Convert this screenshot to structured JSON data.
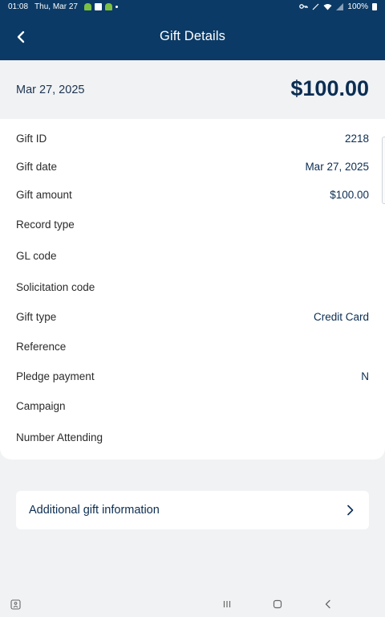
{
  "status_bar": {
    "time": "01:08",
    "date": "Thu, Mar 27",
    "battery": "100%"
  },
  "app_bar": {
    "title": "Gift Details"
  },
  "summary": {
    "date": "Mar 27, 2025",
    "amount": "$100.00"
  },
  "details": [
    {
      "label": "Gift ID",
      "value": "2218"
    },
    {
      "label": "Gift date",
      "value": "Mar 27, 2025"
    },
    {
      "label": "Gift amount",
      "value": "$100.00"
    },
    {
      "label": "Record type",
      "value": ""
    },
    {
      "label": "GL code",
      "value": ""
    },
    {
      "label": "Solicitation code",
      "value": ""
    },
    {
      "label": "Gift type",
      "value": "Credit Card"
    },
    {
      "label": "Reference",
      "value": ""
    },
    {
      "label": "Pledge payment",
      "value": "N"
    },
    {
      "label": "Campaign",
      "value": ""
    },
    {
      "label": "Number Attending",
      "value": ""
    }
  ],
  "additional": {
    "label": "Additional gift information"
  }
}
